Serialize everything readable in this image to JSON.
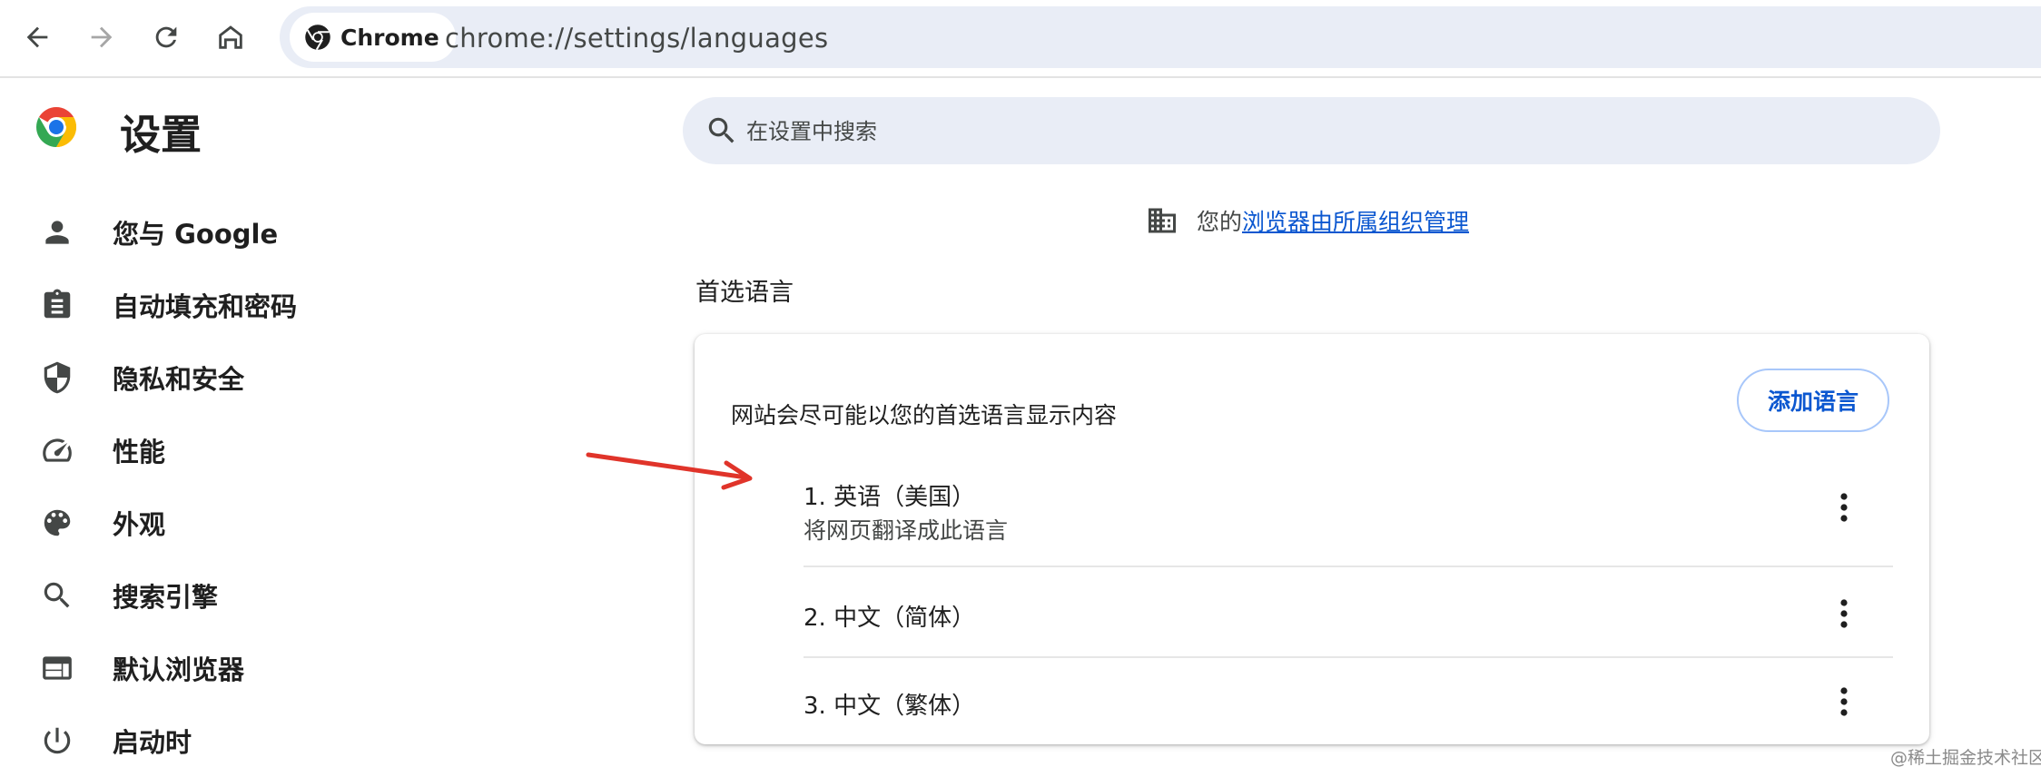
{
  "browser": {
    "chip_label": "Chrome",
    "url": "chrome://settings/languages"
  },
  "sidebar": {
    "title": "设置",
    "items": [
      {
        "label": "您与 Google",
        "icon": "person-icon"
      },
      {
        "label": "自动填充和密码",
        "icon": "clipboard-icon"
      },
      {
        "label": "隐私和安全",
        "icon": "shield-icon"
      },
      {
        "label": "性能",
        "icon": "speedometer-icon"
      },
      {
        "label": "外观",
        "icon": "palette-icon"
      },
      {
        "label": "搜索引擎",
        "icon": "search-icon"
      },
      {
        "label": "默认浏览器",
        "icon": "browser-window-icon"
      },
      {
        "label": "启动时",
        "icon": "power-icon"
      }
    ]
  },
  "search": {
    "placeholder": "在设置中搜索"
  },
  "managed": {
    "prefix": "您的",
    "link": "浏览器由所属组织管理"
  },
  "languages": {
    "section_title": "首选语言",
    "description": "网站会尽可能以您的首选语言显示内容",
    "add_button": "添加语言",
    "items": [
      {
        "name": "1. 英语（美国）",
        "sub": "将网页翻译成此语言"
      },
      {
        "name": "2. 中文（简体）"
      },
      {
        "name": "3. 中文（繁体）"
      }
    ]
  },
  "annotation": {
    "arrow_color": "#e0342a"
  },
  "watermark": "@稀土掘金技术社区",
  "colors": {
    "accent": "#0b57d0",
    "omnibox_bg": "#e9edf6",
    "icon_gray": "#444746"
  }
}
